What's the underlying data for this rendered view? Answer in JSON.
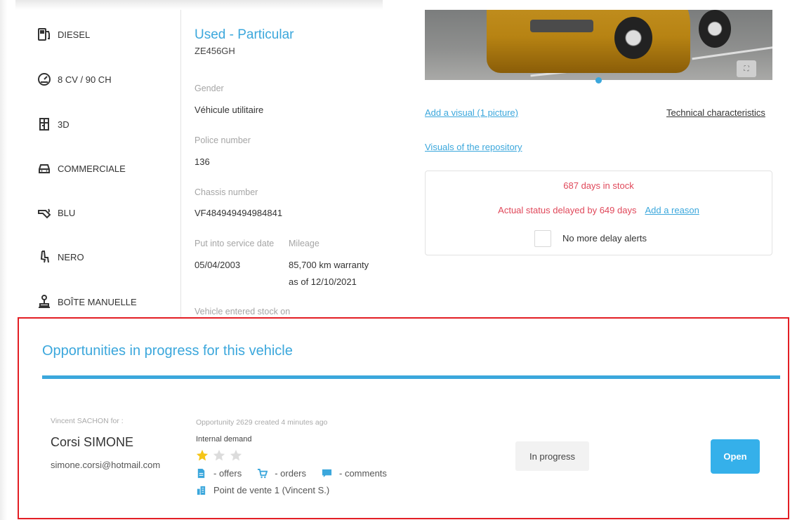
{
  "specs": [
    {
      "icon": "fuel-pump-icon",
      "label": "DIESEL"
    },
    {
      "icon": "speedometer-icon",
      "label": "8 CV / 90 CH"
    },
    {
      "icon": "car-doors-icon",
      "label": "3D"
    },
    {
      "icon": "car-body-icon",
      "label": "COMMERCIALE"
    },
    {
      "icon": "paint-color-icon",
      "label": "BLU"
    },
    {
      "icon": "interior-seat-icon",
      "label": "NERO"
    },
    {
      "icon": "gearbox-icon",
      "label": "BOÎTE MANUELLE"
    }
  ],
  "details": {
    "status": "Used - Particular",
    "plate": "ZE456GH",
    "gender_label": "Gender",
    "gender_value": "Véhicule utilitaire",
    "police_label": "Police number",
    "police_value": "136",
    "chassis_label": "Chassis number",
    "chassis_value": "VF484949494984841",
    "service_date_label": "Put into service date",
    "service_date_value": "05/04/2003",
    "mileage_label": "Mileage",
    "mileage_value_1": "85,700 km warranty",
    "mileage_value_2": "as of 12/10/2021",
    "entered_stock_label": "Vehicle entered stock on"
  },
  "media": {
    "add_visual": "Add a visual (1 picture)",
    "technical": "Technical characteristics",
    "repository": "Visuals of the repository",
    "expand_icon": "expand-icon"
  },
  "stock": {
    "days": "687 days in stock",
    "delay": "Actual status delayed by 649 days",
    "add_reason": "Add a reason",
    "no_alerts": "No more delay alerts"
  },
  "opportunities": {
    "title": "Opportunities in progress for this vehicle",
    "for_label": "Vincent SACHON for :",
    "customer_name": "Corsi SIMONE",
    "customer_email": "simone.corsi@hotmail.com",
    "created": "Opportunity 2629 created 4 minutes ago",
    "type": "Internal demand",
    "rating": 1,
    "rating_max": 3,
    "offers": "- offers",
    "orders": "- orders",
    "comments": "- comments",
    "site": "Point de vente 1 (Vincent S.)",
    "status": "In progress",
    "open": "Open"
  },
  "colors": {
    "accent": "#3ba7dc",
    "alert": "#e0485a",
    "highlight_border": "#e31e24",
    "star_on": "#f5c518",
    "star_off": "#dcdcdc"
  }
}
